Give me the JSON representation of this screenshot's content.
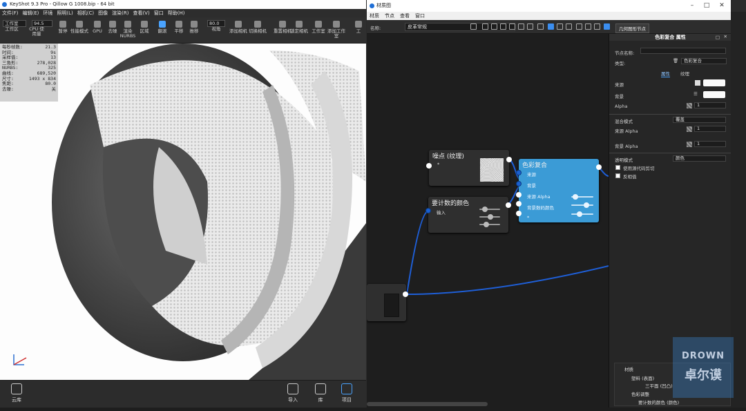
{
  "ks_window": {
    "title": "KeyShot 9.3 Pro - Qillow G 1008.bip - 64 bit",
    "menu": [
      "文件(F)",
      "编辑(E)",
      "环境",
      "照明(L)",
      "相机(C)",
      "图像",
      "渲染(R)",
      "查看(V)",
      "窗口",
      "帮助(H)"
    ],
    "workspace_label": "工作室",
    "cpu_value": "94.5",
    "zoom_value": "80.0",
    "toolbar": [
      {
        "label": "工作区",
        "icon": "workspace-icon"
      },
      {
        "label": "CPU 使用量",
        "icon": "cpu-icon"
      },
      {
        "label": "暂停",
        "icon": "pause-icon"
      },
      {
        "label": "性能模式",
        "icon": "performance-icon"
      },
      {
        "label": "GPU",
        "icon": "gpu-icon"
      },
      {
        "label": "去噪",
        "icon": "denoise-icon"
      },
      {
        "label": "渲染 NURBS",
        "icon": "nurbs-icon"
      },
      {
        "label": "区域",
        "icon": "region-icon"
      },
      {
        "label": "翻滚",
        "icon": "tumble-icon",
        "active": true
      },
      {
        "label": "平移",
        "icon": "pan-icon"
      },
      {
        "label": "推移",
        "icon": "dolly-icon"
      },
      {
        "label": "视角",
        "icon": "fov-icon"
      },
      {
        "label": "添加相机",
        "icon": "add-camera-icon"
      },
      {
        "label": "切换相机",
        "icon": "switch-camera-icon"
      },
      {
        "label": "重置相机",
        "icon": "reset-camera-icon"
      },
      {
        "label": "锁定相机",
        "icon": "lock-camera-icon"
      },
      {
        "label": "工作室",
        "icon": "studio-icon"
      },
      {
        "label": "添加工作室",
        "icon": "add-studio-icon"
      },
      {
        "label": "工",
        "icon": "more-icon"
      }
    ],
    "stats": [
      {
        "k": "每秒帧数:",
        "v": "21.3"
      },
      {
        "k": "时间:",
        "v": "9s"
      },
      {
        "k": "采样值:",
        "v": "13"
      },
      {
        "k": "三角形:",
        "v": "278,028"
      },
      {
        "k": "NURBS:",
        "v": "325"
      },
      {
        "k": "曲线:",
        "v": "689,520"
      },
      {
        "k": "尺寸:",
        "v": "1493 x 834"
      },
      {
        "k": "焦距:",
        "v": "80.0"
      },
      {
        "k": "去噪:",
        "v": "关"
      }
    ],
    "bottom": [
      {
        "label": "云库",
        "icon": "cloud-library-icon"
      },
      {
        "label": "导入",
        "icon": "import-icon"
      },
      {
        "label": "库",
        "icon": "library-icon"
      },
      {
        "label": "项目",
        "icon": "project-icon",
        "active": true
      }
    ]
  },
  "mg_window": {
    "title": "材质图",
    "menu": [
      "材质",
      "节点",
      "查看",
      "窗口"
    ],
    "name_label": "名称:",
    "name_value": "皮革常规",
    "geometry_button": "几何图形节点"
  },
  "nodes": {
    "noise": {
      "title": "噪点 (纹理)",
      "port": "*"
    },
    "color_calc": {
      "title": "要计数的颜色",
      "port": "输入"
    },
    "color_composite": {
      "title": "色彩复合",
      "ports": [
        "来源",
        "背景",
        "来源 Alpha",
        "背景数码颜色",
        "*"
      ]
    }
  },
  "props": {
    "header": "色彩复合 属性",
    "node_name_label": "节点名称:",
    "type_label": "类型:",
    "type_value": "色彩复合",
    "tabs": [
      "属性",
      "纹理"
    ],
    "source_label": "来源",
    "background_label": "背景",
    "alpha_label": "Alpha",
    "alpha_value": "1",
    "blend_mode_label": "混合模式",
    "blend_mode_value": "覆盖",
    "source_alpha_label": "来源 Alpha",
    "source_alpha_value": "1",
    "bg_alpha_label": "背景 Alpha",
    "bg_alpha_value": "1",
    "alpha_mode_label": "透明模式",
    "alpha_mode_value": "颜色",
    "use_alpha_label": "使用源代码剪切",
    "invert_label": "反相值",
    "colors": {
      "swatch": "#fafafa",
      "accent": "#3b9bd6"
    }
  },
  "scene_tree": [
    "材质",
    "塑料 (表面)",
    "三平面 (凹凸)",
    "色彩调整",
    "要计数的颜色 (颜色)"
  ],
  "watermark": {
    "top": "DROWN",
    "bottom": "卓尔谟"
  }
}
